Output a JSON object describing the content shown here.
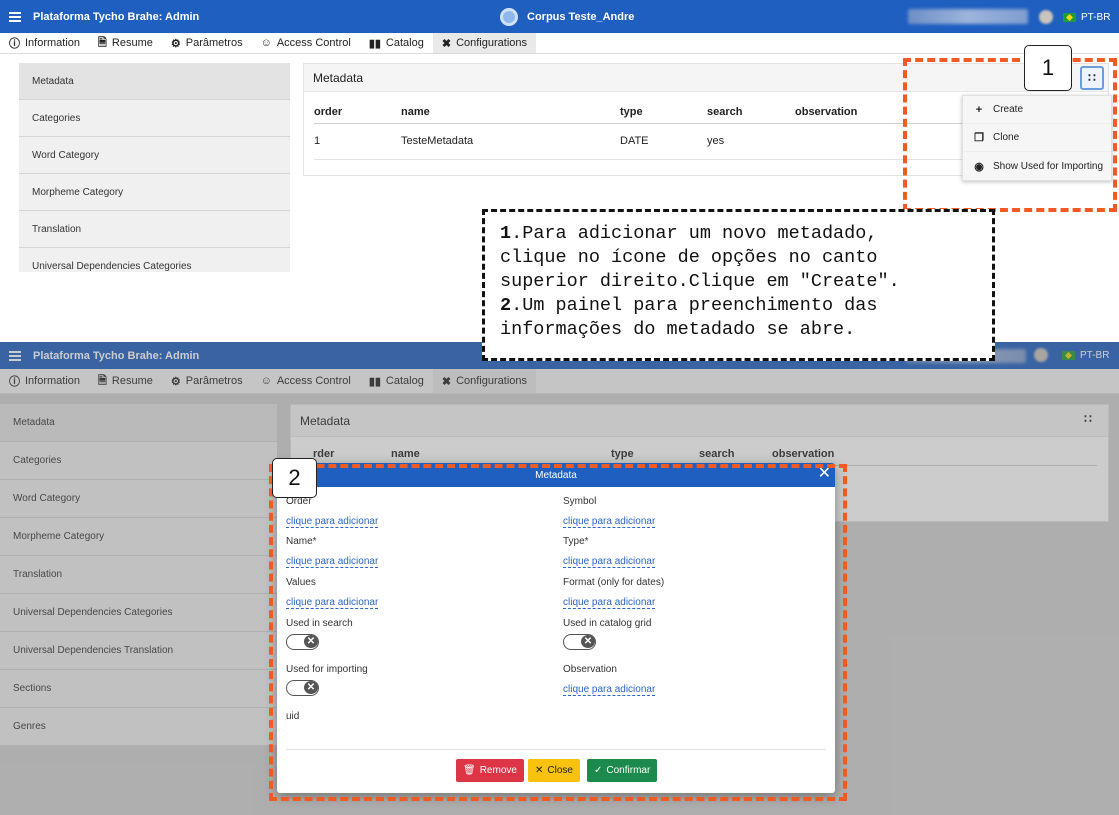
{
  "app": {
    "title": "Plataforma Tycho Brahe: Admin",
    "corpus": "Corpus Teste_Andre",
    "language": "PT-BR"
  },
  "tabs": [
    {
      "label": "Information",
      "icon": "info-icon"
    },
    {
      "label": "Resume",
      "icon": "document-icon"
    },
    {
      "label": "Parâmetros",
      "icon": "gears-icon"
    },
    {
      "label": "Access Control",
      "icon": "users-icon"
    },
    {
      "label": "Catalog",
      "icon": "book-icon"
    },
    {
      "label": "Configurations",
      "icon": "tools-icon"
    }
  ],
  "sidebar_top": [
    "Metadata",
    "Categories",
    "Word Category",
    "Morpheme Category",
    "Translation",
    "Universal Dependencies Categories"
  ],
  "sidebar_bottom": [
    "Metadata",
    "Categories",
    "Word Category",
    "Morpheme Category",
    "Translation",
    "Universal Dependencies Categories",
    "Universal Dependencies Translation",
    "Sections",
    "Genres"
  ],
  "panel": {
    "title": "Metadata",
    "columns": [
      "order",
      "name",
      "type",
      "search",
      "observation"
    ],
    "columns_bottom": [
      "rder",
      "name",
      "type",
      "search",
      "observation"
    ],
    "rows": [
      {
        "order": "1",
        "name": "TesteMetadata",
        "type": "DATE",
        "search": "yes",
        "observation": ""
      }
    ]
  },
  "options_menu": [
    {
      "label": "Create",
      "icon": "plus-icon"
    },
    {
      "label": "Clone",
      "icon": "clone-icon"
    },
    {
      "label": "Show Used for Importing",
      "icon": "eye-icon"
    }
  ],
  "modal": {
    "title": "Metadata",
    "link_text": "clique para adicionar",
    "order_label": "Order",
    "symbol_label": "Symbol",
    "name_label": "Name*",
    "type_label": "Type*",
    "values_label": "Values",
    "format_label": "Format (only for dates)",
    "used_in_search_label": "Used in search",
    "used_in_catalog_label": "Used in catalog grid",
    "used_for_importing_label": "Used for importing",
    "observation_label": "Observation",
    "uid_label": "uid",
    "remove_label": "Remove",
    "close_label": "Close",
    "confirm_label": "Confirmar"
  },
  "annotations": {
    "badge_1": "1",
    "badge_2": "2",
    "step1_num": "1",
    "step1_text": ".Para adicionar um novo metadado,\nclique no ícone de opções no canto\nsuperior direito.Clique em \"Create\".",
    "step2_num": "2",
    "step2_text": ".Um painel para preenchimento das\ninformações do metadado se abre."
  },
  "colors": {
    "header_blue": "#1e5fc0",
    "annotation_orange": "#f05a23",
    "remove_red": "#dd3545",
    "close_yellow": "#f8c20e",
    "confirm_green": "#1b8a4c"
  }
}
